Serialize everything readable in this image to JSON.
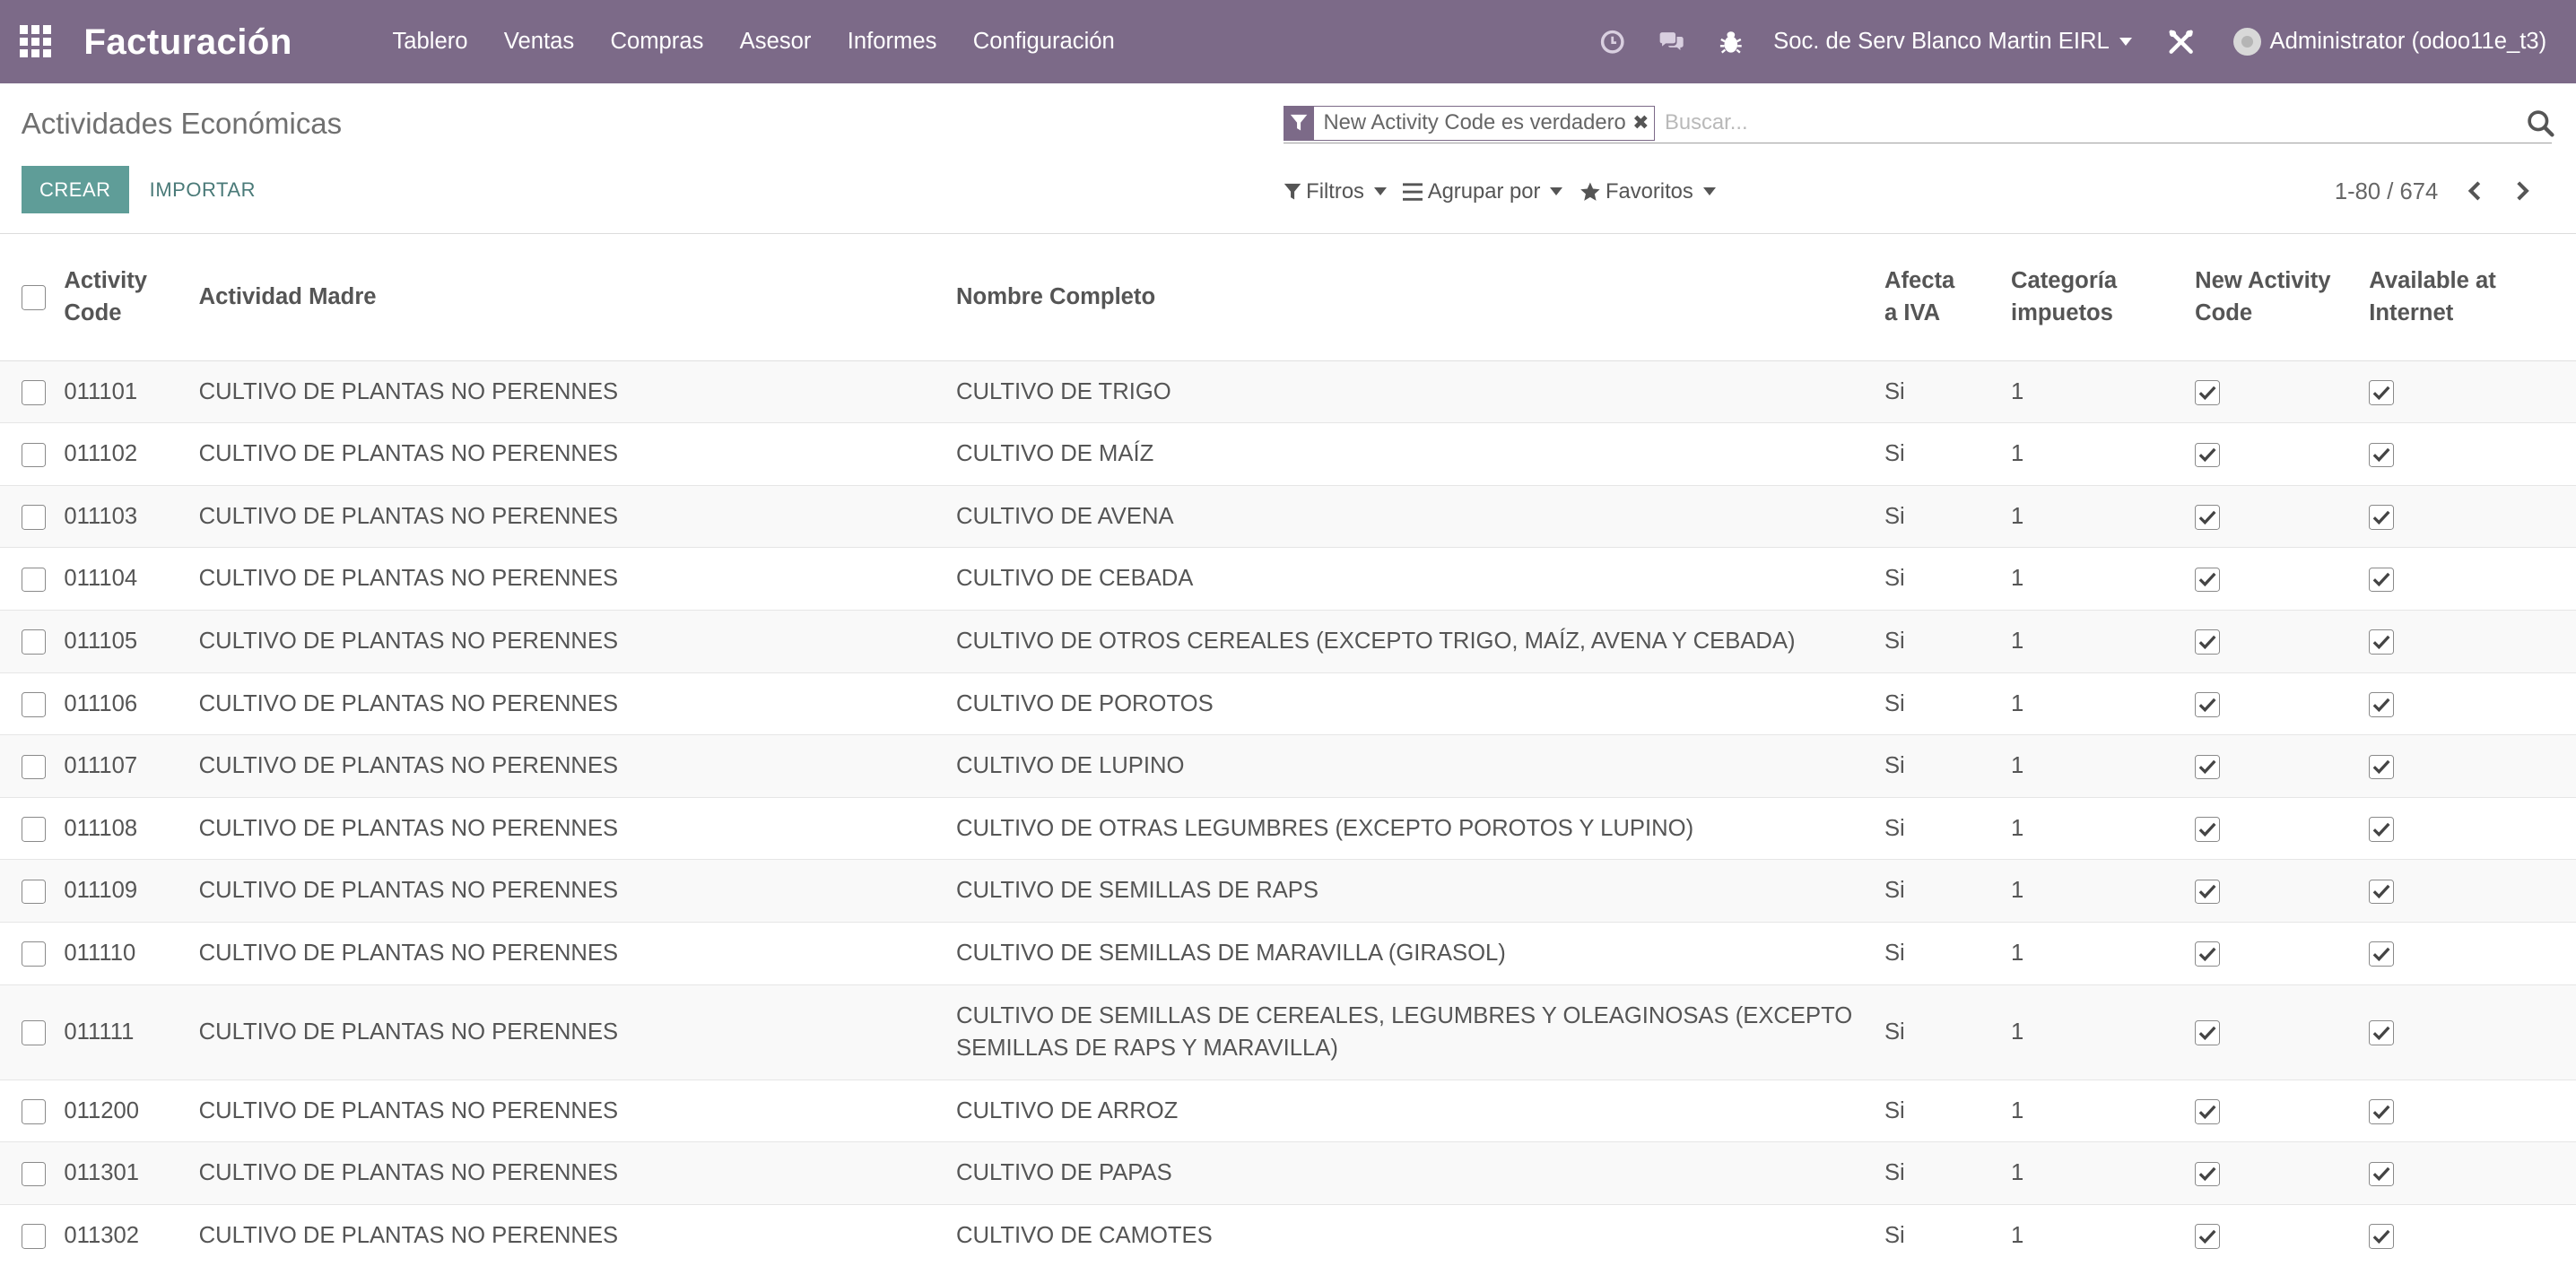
{
  "navbar": {
    "brand": "Facturación",
    "menu": [
      "Tablero",
      "Ventas",
      "Compras",
      "Asesor",
      "Informes",
      "Configuración"
    ],
    "company": "Soc. de Serv Blanco Martin EIRL",
    "user": "Administrator (odoo11e_t3)"
  },
  "control": {
    "title": "Actividades Económicas",
    "create_label": "CREAR",
    "import_label": "IMPORTAR",
    "facet_label": "New Activity Code es verdadero",
    "search_placeholder": "Buscar...",
    "filters_label": "Filtros",
    "group_label": "Agrupar por",
    "favorites_label": "Favoritos",
    "pager": "1-80 / 674"
  },
  "table": {
    "headers": {
      "code": [
        "Activity",
        "Code"
      ],
      "parent": "Actividad Madre",
      "name": "Nombre Completo",
      "iva": [
        "Afecta",
        "a IVA"
      ],
      "tax": [
        "Categoría",
        "impuetos"
      ],
      "new_code": [
        "New Activity",
        "Code"
      ],
      "internet": [
        "Available at",
        "Internet"
      ]
    },
    "rows": [
      {
        "code": "011101",
        "parent": "CULTIVO DE PLANTAS NO PERENNES",
        "name": [
          "CULTIVO DE TRIGO"
        ],
        "iva": "Si",
        "tax": "1",
        "new_code": true,
        "internet": true
      },
      {
        "code": "011102",
        "parent": "CULTIVO DE PLANTAS NO PERENNES",
        "name": [
          "CULTIVO DE MAÍZ"
        ],
        "iva": "Si",
        "tax": "1",
        "new_code": true,
        "internet": true
      },
      {
        "code": "011103",
        "parent": "CULTIVO DE PLANTAS NO PERENNES",
        "name": [
          "CULTIVO DE AVENA"
        ],
        "iva": "Si",
        "tax": "1",
        "new_code": true,
        "internet": true
      },
      {
        "code": "011104",
        "parent": "CULTIVO DE PLANTAS NO PERENNES",
        "name": [
          "CULTIVO DE CEBADA"
        ],
        "iva": "Si",
        "tax": "1",
        "new_code": true,
        "internet": true
      },
      {
        "code": "011105",
        "parent": "CULTIVO DE PLANTAS NO PERENNES",
        "name": [
          "CULTIVO DE OTROS CEREALES (EXCEPTO TRIGO, MAÍZ, AVENA Y CEBADA)"
        ],
        "iva": "Si",
        "tax": "1",
        "new_code": true,
        "internet": true
      },
      {
        "code": "011106",
        "parent": "CULTIVO DE PLANTAS NO PERENNES",
        "name": [
          "CULTIVO DE POROTOS"
        ],
        "iva": "Si",
        "tax": "1",
        "new_code": true,
        "internet": true
      },
      {
        "code": "011107",
        "parent": "CULTIVO DE PLANTAS NO PERENNES",
        "name": [
          "CULTIVO DE LUPINO"
        ],
        "iva": "Si",
        "tax": "1",
        "new_code": true,
        "internet": true
      },
      {
        "code": "011108",
        "parent": "CULTIVO DE PLANTAS NO PERENNES",
        "name": [
          "CULTIVO DE OTRAS LEGUMBRES (EXCEPTO POROTOS Y LUPINO)"
        ],
        "iva": "Si",
        "tax": "1",
        "new_code": true,
        "internet": true
      },
      {
        "code": "011109",
        "parent": "CULTIVO DE PLANTAS NO PERENNES",
        "name": [
          "CULTIVO DE SEMILLAS DE RAPS"
        ],
        "iva": "Si",
        "tax": "1",
        "new_code": true,
        "internet": true
      },
      {
        "code": "011110",
        "parent": "CULTIVO DE PLANTAS NO PERENNES",
        "name": [
          "CULTIVO DE SEMILLAS DE MARAVILLA (GIRASOL)"
        ],
        "iva": "Si",
        "tax": "1",
        "new_code": true,
        "internet": true
      },
      {
        "code": "011111",
        "parent": "CULTIVO DE PLANTAS NO PERENNES",
        "name": [
          "CULTIVO DE SEMILLAS DE CEREALES, LEGUMBRES Y OLEAGINOSAS (EXCEPTO",
          "SEMILLAS DE RAPS Y MARAVILLA)"
        ],
        "iva": "Si",
        "tax": "1",
        "new_code": true,
        "internet": true
      },
      {
        "code": "011200",
        "parent": "CULTIVO DE PLANTAS NO PERENNES",
        "name": [
          "CULTIVO DE ARROZ"
        ],
        "iva": "Si",
        "tax": "1",
        "new_code": true,
        "internet": true
      },
      {
        "code": "011301",
        "parent": "CULTIVO DE PLANTAS NO PERENNES",
        "name": [
          "CULTIVO DE PAPAS"
        ],
        "iva": "Si",
        "tax": "1",
        "new_code": true,
        "internet": true
      },
      {
        "code": "011302",
        "parent": "CULTIVO DE PLANTAS NO PERENNES",
        "name": [
          "CULTIVO DE CAMOTES"
        ],
        "iva": "Si",
        "tax": "1",
        "new_code": true,
        "internet": true
      }
    ]
  },
  "colors": {
    "navbar": "#7c6a88",
    "primary_button": "#5f9d98"
  }
}
